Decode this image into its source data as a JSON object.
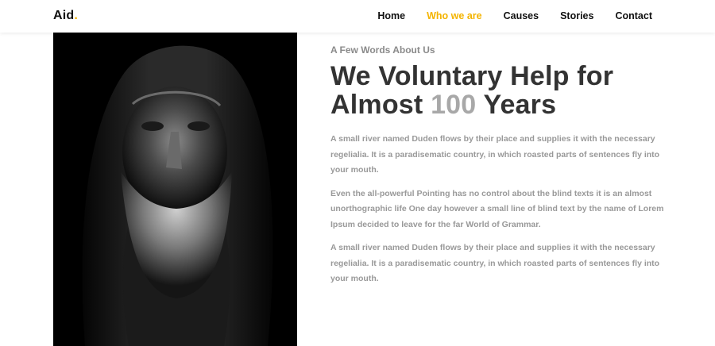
{
  "brand": {
    "name": "Aid",
    "dot": "."
  },
  "nav": {
    "items": [
      {
        "label": "Home",
        "active": false
      },
      {
        "label": "Who we are",
        "active": true
      },
      {
        "label": "Causes",
        "active": false
      },
      {
        "label": "Stories",
        "active": false
      },
      {
        "label": "Contact",
        "active": false
      }
    ]
  },
  "about": {
    "eyebrow": "A Few Words About Us",
    "heading_line1": "We Voluntary Help for",
    "heading_line2_pre": "Almost ",
    "heading_number": "100",
    "heading_line2_post": " Years",
    "paragraphs": [
      "A small river named Duden flows by their place and supplies it with the necessary regelialia. It is a paradisematic country, in which roasted parts of sentences fly into your mouth.",
      "Even the all-powerful Pointing has no control about the blind texts it is an almost unorthographic life One day however a small line of blind text by the name of Lorem Ipsum decided to leave for the far World of Grammar.",
      "A small river named Duden flows by their place and supplies it with the necessary regelialia. It is a paradisematic country, in which roasted parts of sentences fly into your mouth."
    ]
  },
  "colors": {
    "accent": "#f4b400",
    "heading": "#333333",
    "muted": "#999999"
  }
}
